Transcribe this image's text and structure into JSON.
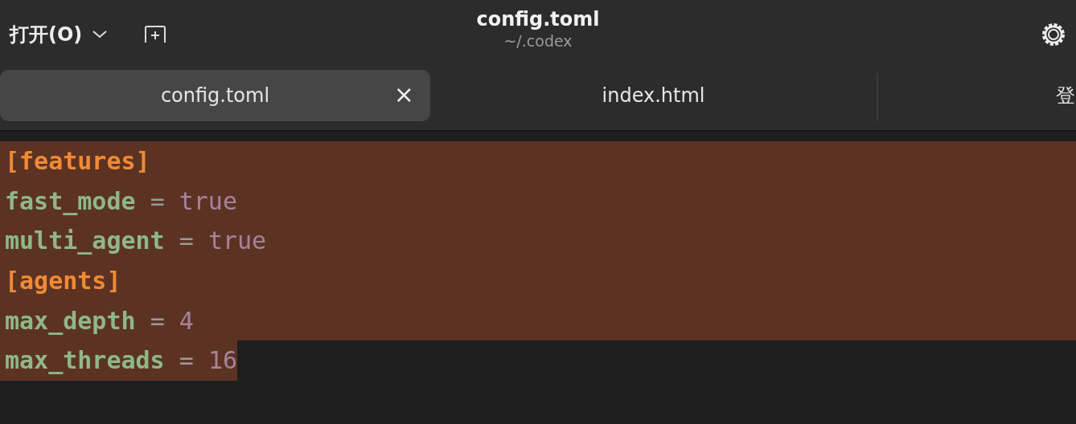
{
  "header": {
    "open_menu": "打开(O)",
    "title": "config.toml",
    "subtitle": "~/.codex"
  },
  "tabs": [
    {
      "label": "config.toml",
      "selected": true,
      "close": "×"
    },
    {
      "label": "index.html",
      "selected": false
    },
    {
      "label": "登",
      "selected": false
    }
  ],
  "editor": {
    "lines": [
      {
        "selected": true,
        "full_width": true,
        "tokens": [
          {
            "kind": "section",
            "text": "[features]"
          }
        ]
      },
      {
        "selected": true,
        "full_width": true,
        "tokens": [
          {
            "kind": "key",
            "text": "fast_mode"
          },
          {
            "kind": "op",
            "text": "="
          },
          {
            "kind": "value",
            "text": "true"
          }
        ]
      },
      {
        "selected": true,
        "full_width": true,
        "tokens": [
          {
            "kind": "key",
            "text": "multi_agent"
          },
          {
            "kind": "op",
            "text": "="
          },
          {
            "kind": "value",
            "text": "true"
          }
        ]
      },
      {
        "selected": true,
        "full_width": true,
        "tokens": [
          {
            "kind": "section",
            "text": "[agents]"
          }
        ]
      },
      {
        "selected": true,
        "full_width": true,
        "tokens": [
          {
            "kind": "key",
            "text": "max_depth"
          },
          {
            "kind": "op",
            "text": "="
          },
          {
            "kind": "value",
            "text": "4"
          }
        ]
      },
      {
        "selected": true,
        "full_width": false,
        "tokens": [
          {
            "kind": "key",
            "text": "max_threads"
          },
          {
            "kind": "op",
            "text": "="
          },
          {
            "kind": "value",
            "text": "16"
          }
        ]
      }
    ]
  }
}
